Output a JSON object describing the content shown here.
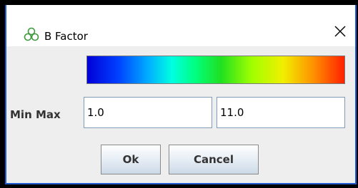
{
  "window": {
    "title": "B Factor",
    "close_glyph": "✕",
    "icon": "molecule-cluster-icon",
    "icon_color": "#3c9a3c"
  },
  "color_scale": {
    "colors": [
      "#0000d8",
      "#0040ff",
      "#00b0ff",
      "#00ffe0",
      "#00ff80",
      "#20e020",
      "#a0ff00",
      "#f0f000",
      "#ff9000",
      "#ff2000"
    ]
  },
  "range": {
    "label": "Min Max",
    "min_value": "1.0",
    "max_value": "11.0"
  },
  "buttons": {
    "ok_label": "Ok",
    "cancel_label": "Cancel"
  }
}
